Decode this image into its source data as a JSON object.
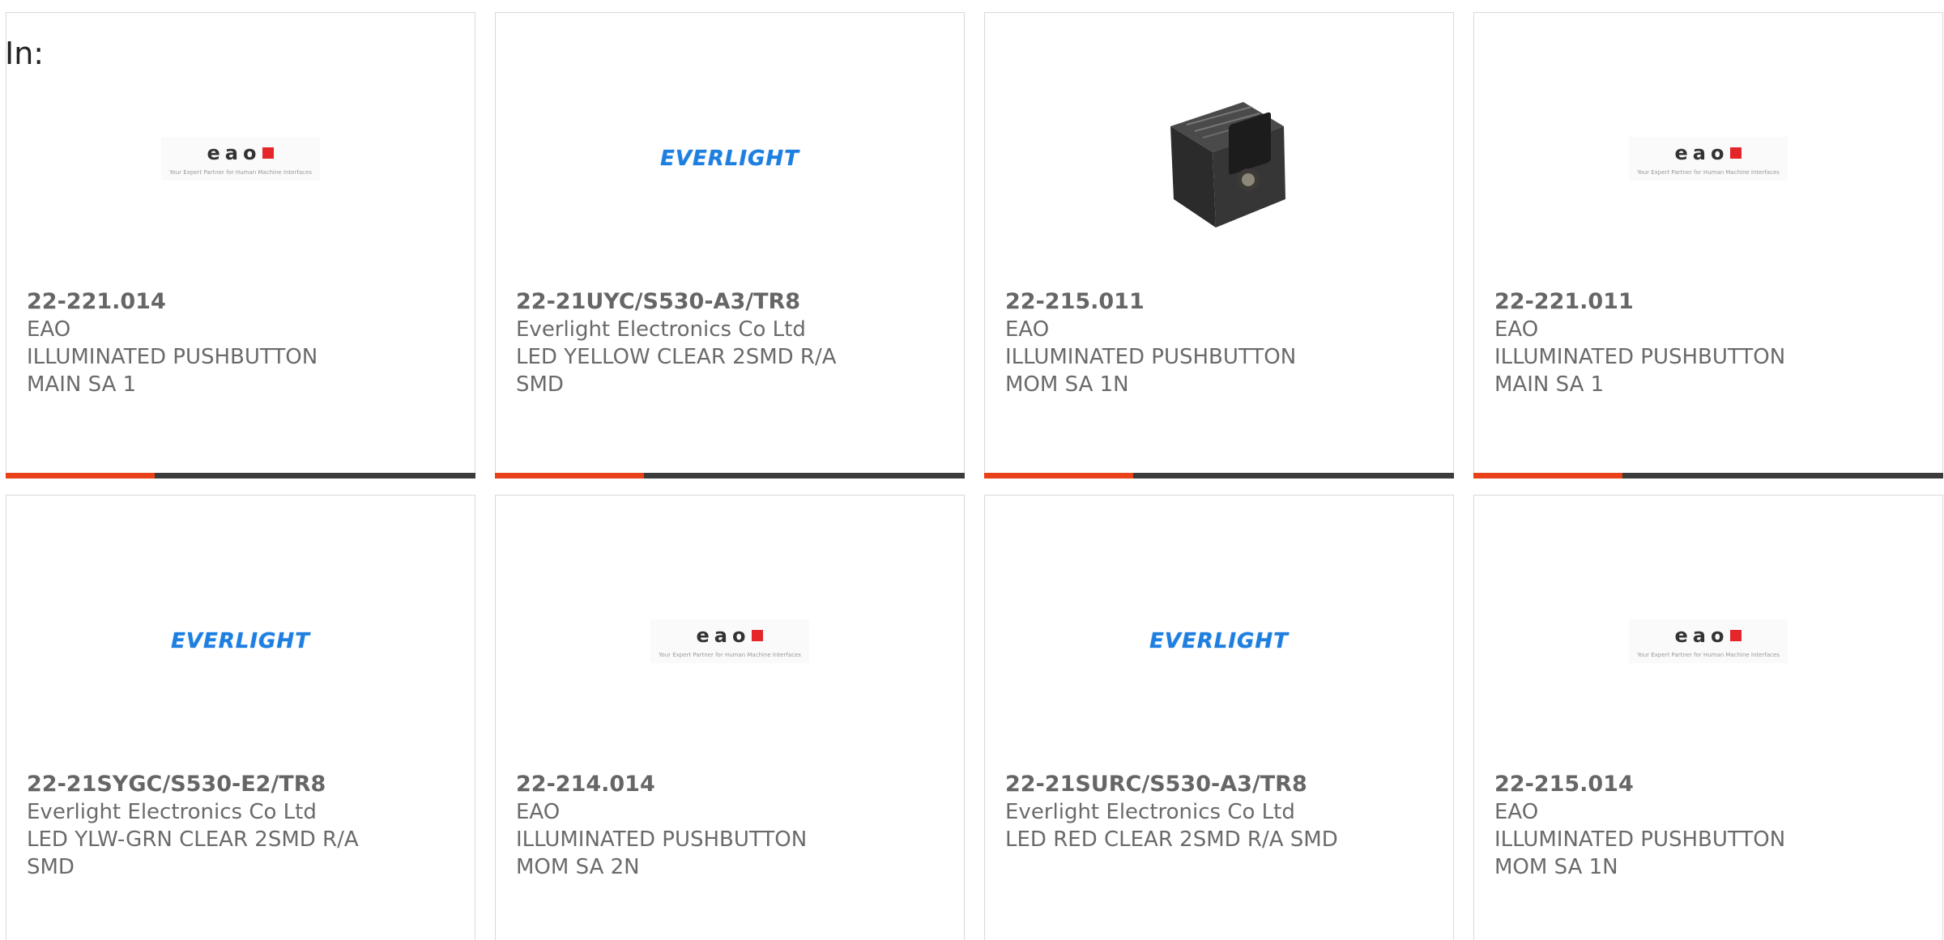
{
  "header": {
    "in_label": "In:"
  },
  "logos": {
    "eao_word": "eao",
    "eao_tagline": "Your Expert Partner for Human Machine Interfaces",
    "everlight_word": "EVERLIGHT"
  },
  "colors": {
    "accent": "#e9421a",
    "bar": "#3b3b3b",
    "text": "#6a6a6a",
    "everlight_blue": "#1e7fe0",
    "eao_red": "#e4262b"
  },
  "products": [
    {
      "part_number": "22-221.014",
      "manufacturer": "EAO",
      "desc1": "ILLUMINATED PUSHBUTTON",
      "desc2": "MAIN SA 1",
      "image": "eao-logo"
    },
    {
      "part_number": "22-21UYC/S530-A3/TR8",
      "manufacturer": "Everlight Electronics Co Ltd",
      "desc1": "LED YELLOW CLEAR 2SMD R/A",
      "desc2": "SMD",
      "image": "everlight-logo"
    },
    {
      "part_number": "22-215.011",
      "manufacturer": "EAO",
      "desc1": "ILLUMINATED PUSHBUTTON",
      "desc2": "MOM SA 1N",
      "image": "product-photo"
    },
    {
      "part_number": "22-221.011",
      "manufacturer": "EAO",
      "desc1": "ILLUMINATED PUSHBUTTON",
      "desc2": "MAIN SA 1",
      "image": "eao-logo"
    },
    {
      "part_number": "22-21SYGC/S530-E2/TR8",
      "manufacturer": "Everlight Electronics Co Ltd",
      "desc1": "LED YLW-GRN CLEAR 2SMD R/A",
      "desc2": "SMD",
      "image": "everlight-logo"
    },
    {
      "part_number": "22-214.014",
      "manufacturer": "EAO",
      "desc1": "ILLUMINATED PUSHBUTTON",
      "desc2": "MOM SA 2N",
      "image": "eao-logo"
    },
    {
      "part_number": "22-21SURC/S530-A3/TR8",
      "manufacturer": "Everlight Electronics Co Ltd",
      "desc1": "LED RED CLEAR 2SMD R/A SMD",
      "desc2": "",
      "image": "everlight-logo"
    },
    {
      "part_number": "22-215.014",
      "manufacturer": "EAO",
      "desc1": "ILLUMINATED PUSHBUTTON",
      "desc2": "MOM SA 1N",
      "image": "eao-logo"
    }
  ]
}
